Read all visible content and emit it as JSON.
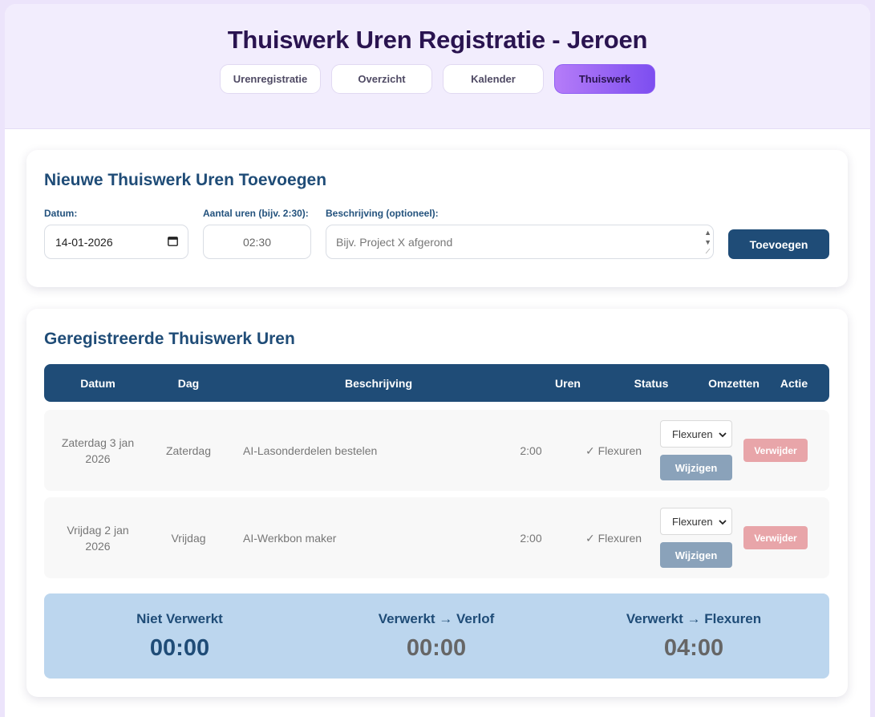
{
  "header": {
    "title": "Thuiswerk Uren Registratie - Jeroen",
    "tabs": [
      {
        "label": "Urenregistratie",
        "active": false
      },
      {
        "label": "Overzicht",
        "active": false
      },
      {
        "label": "Kalender",
        "active": false
      },
      {
        "label": "Thuiswerk",
        "active": true
      }
    ]
  },
  "form": {
    "title": "Nieuwe Thuiswerk Uren Toevoegen",
    "date_label": "Datum:",
    "date_value": "14-01-2026",
    "hours_label": "Aantal uren (bijv. 2:30):",
    "hours_value": "02:30",
    "desc_label": "Beschrijving (optioneel):",
    "desc_placeholder": "Bijv. Project X afgerond",
    "add_label": "Toevoegen"
  },
  "list": {
    "title": "Geregistreerde Thuiswerk Uren",
    "columns": [
      "Datum",
      "Dag",
      "Beschrijving",
      "Uren",
      "Status",
      "Omzetten",
      "Actie"
    ],
    "rows": [
      {
        "date": "Zaterdag 3 jan 2026",
        "day": "Zaterdag",
        "description": "AI-Lasonderdelen bestelen",
        "hours": "2:00",
        "status": "✓ Flexuren",
        "convert_option": "Flexuren",
        "edit_label": "Wijzigen",
        "delete_label": "Verwijder"
      },
      {
        "date": "Vrijdag 2 jan 2026",
        "day": "Vrijdag",
        "description": "AI-Werkbon maker",
        "hours": "2:00",
        "status": "✓ Flexuren",
        "convert_option": "Flexuren",
        "edit_label": "Wijzigen",
        "delete_label": "Verwijder"
      }
    ]
  },
  "summary": [
    {
      "label": "Niet Verwerkt",
      "value": "00:00",
      "color": "#1f4c77"
    },
    {
      "label": "Verwerkt → Verlof",
      "value": "00:00",
      "color": "#666666"
    },
    {
      "label": "Verwerkt → Flexuren",
      "value": "04:00",
      "color": "#666666"
    }
  ],
  "colors": {
    "primary": "#1f4c77",
    "accent_purple": "#8d5ef2",
    "delete": "#e8a5a9",
    "edit": "#8aa2ba",
    "summary_bg": "#bcd6ee"
  }
}
